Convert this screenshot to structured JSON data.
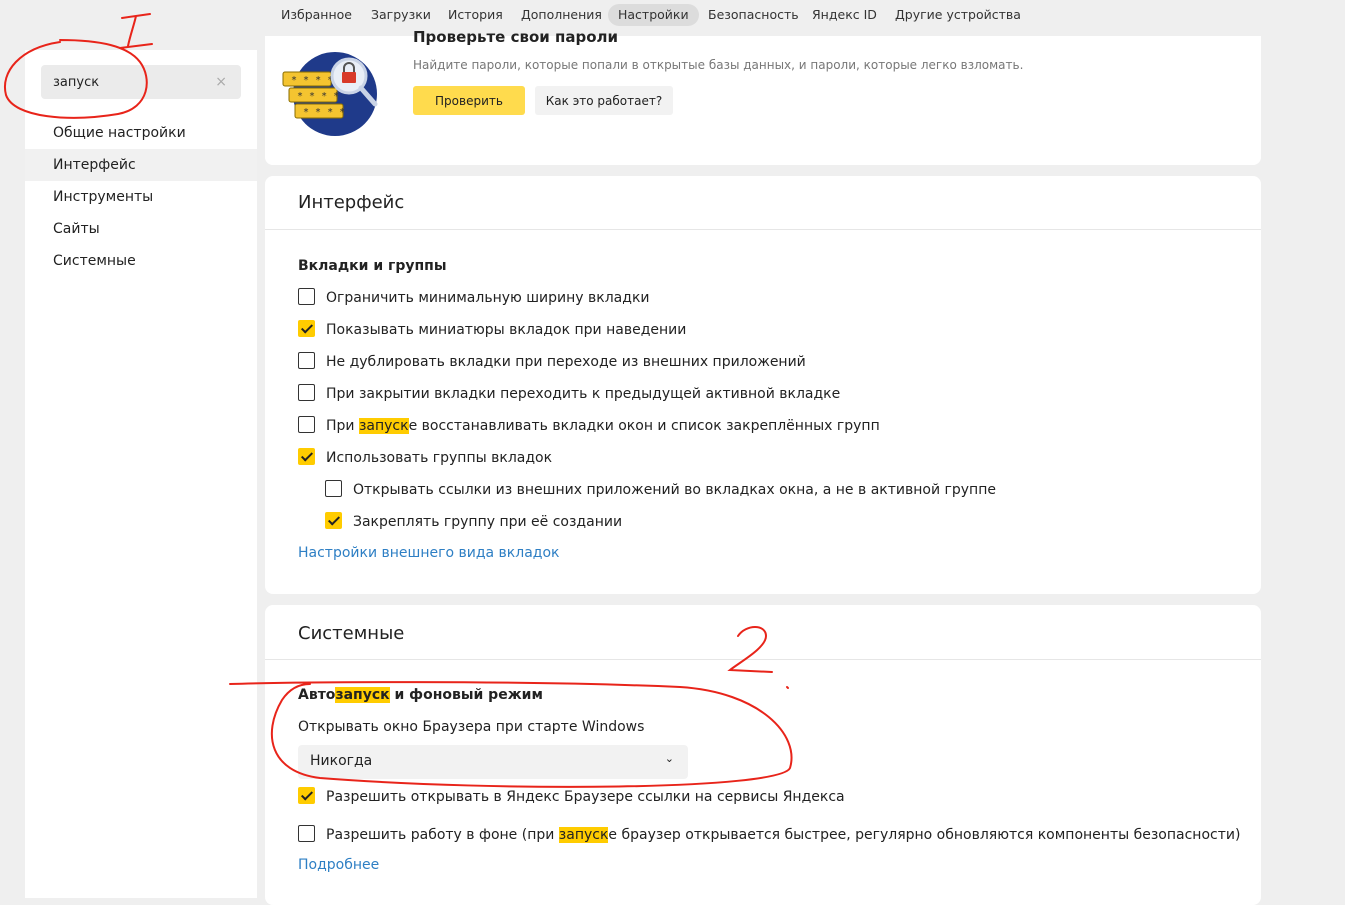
{
  "topnav": {
    "tabs": [
      {
        "label": "Избранное"
      },
      {
        "label": "Загрузки"
      },
      {
        "label": "История"
      },
      {
        "label": "Дополнения"
      },
      {
        "label": "Настройки",
        "active": true
      },
      {
        "label": "Безопасность"
      },
      {
        "label": "Яндекс ID"
      },
      {
        "label": "Другие устройства"
      }
    ]
  },
  "sidebar": {
    "search_value": "запуск",
    "clear_icon": "close-icon",
    "items": [
      {
        "label": "Общие настройки"
      },
      {
        "label": "Интерфейс",
        "active": true
      },
      {
        "label": "Инструменты"
      },
      {
        "label": "Сайты"
      },
      {
        "label": "Системные"
      }
    ]
  },
  "passwords": {
    "title": "Проверьте свои пароли",
    "description": "Найдите пароли, которые попали в открытые базы данных, и пароли, которые легко взломать.",
    "check_button": "Проверить",
    "how_button": "Как это работает?",
    "illustration_icon": "password-magnifier-illustration"
  },
  "interface": {
    "title": "Интерфейс",
    "tabs_section": "Вкладки и группы",
    "options": [
      {
        "text": "Ограничить минимальную ширину вкладки",
        "checked": false
      },
      {
        "text": "Показывать миниатюры вкладок при наведении",
        "checked": true
      },
      {
        "text": "Не дублировать вкладки при переходе из внешних приложений",
        "checked": false
      },
      {
        "text": "При закрытии вкладки переходить к предыдущей активной вкладке",
        "checked": false
      },
      {
        "pre": "При ",
        "hl": "запуск",
        "post": "е восстанавливать вкладки окон и список закреплённых групп",
        "checked": false
      },
      {
        "text": "Использовать группы вкладок",
        "checked": true
      },
      {
        "text": "Открывать ссылки из внешних приложений во вкладках окна, а не в активной группе",
        "checked": false
      },
      {
        "text": "Закреплять группу при её создании",
        "checked": true
      }
    ],
    "appearance_link": "Настройки внешнего вида вкладок"
  },
  "system": {
    "title": "Системные",
    "autostart_pre": "Авто",
    "autostart_hl": "запуск",
    "autostart_post": " и фоновый режим",
    "open_window_label": "Открывать окно Браузера при старте Windows",
    "open_window_value": "Никогда",
    "select_icon": "chevron-down-icon",
    "allow_links": {
      "text": "Разрешить открывать в Яндекс Браузере ссылки на сервисы Яндекса",
      "checked": true
    },
    "background": {
      "pre": "Разрешить работу в фоне (при ",
      "hl": "запуск",
      "post": "е браузер открывается быстрее, регулярно обновляются компоненты безопасности)",
      "checked": false
    },
    "more_link": "Подробнее"
  },
  "annotations": {
    "mark_1": "1",
    "mark_2": "2",
    "color": "#e8241a"
  },
  "colors": {
    "accent_yellow": "#ffcc00",
    "link_blue": "#2e7fc4"
  }
}
